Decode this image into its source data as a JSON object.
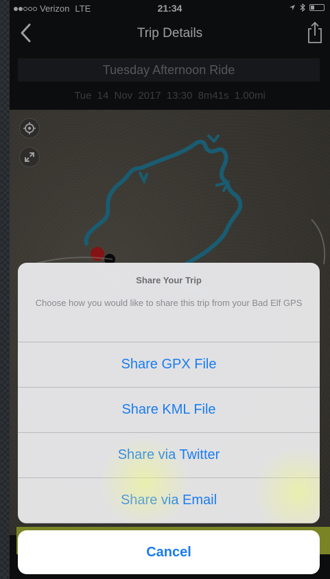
{
  "status_bar": {
    "carrier": "Verizon",
    "network": "LTE",
    "time": "21:34"
  },
  "nav": {
    "title": "Trip Details"
  },
  "trip": {
    "name": "Tuesday Afternoon Ride",
    "stats": "Tue 14 Nov 2017   13:30   8m41s   1.00mi"
  },
  "action_sheet": {
    "title": "Share Your Trip",
    "message": "Choose how you would like to share this trip from your Bad Elf GPS",
    "options": [
      {
        "label": "Share GPX File"
      },
      {
        "label": "Share KML File"
      },
      {
        "label": "Share via Twitter"
      },
      {
        "label": "Share via Email"
      }
    ],
    "cancel_label": "Cancel"
  },
  "colors": {
    "accent": "#1a7cf0",
    "track": "#2a95b6",
    "start_marker": "#d61f1f"
  },
  "icons": [
    "back-chevron-icon",
    "share-icon",
    "locate-icon",
    "expand-icon",
    "location-arrow-icon",
    "bluetooth-icon",
    "battery-icon"
  ]
}
